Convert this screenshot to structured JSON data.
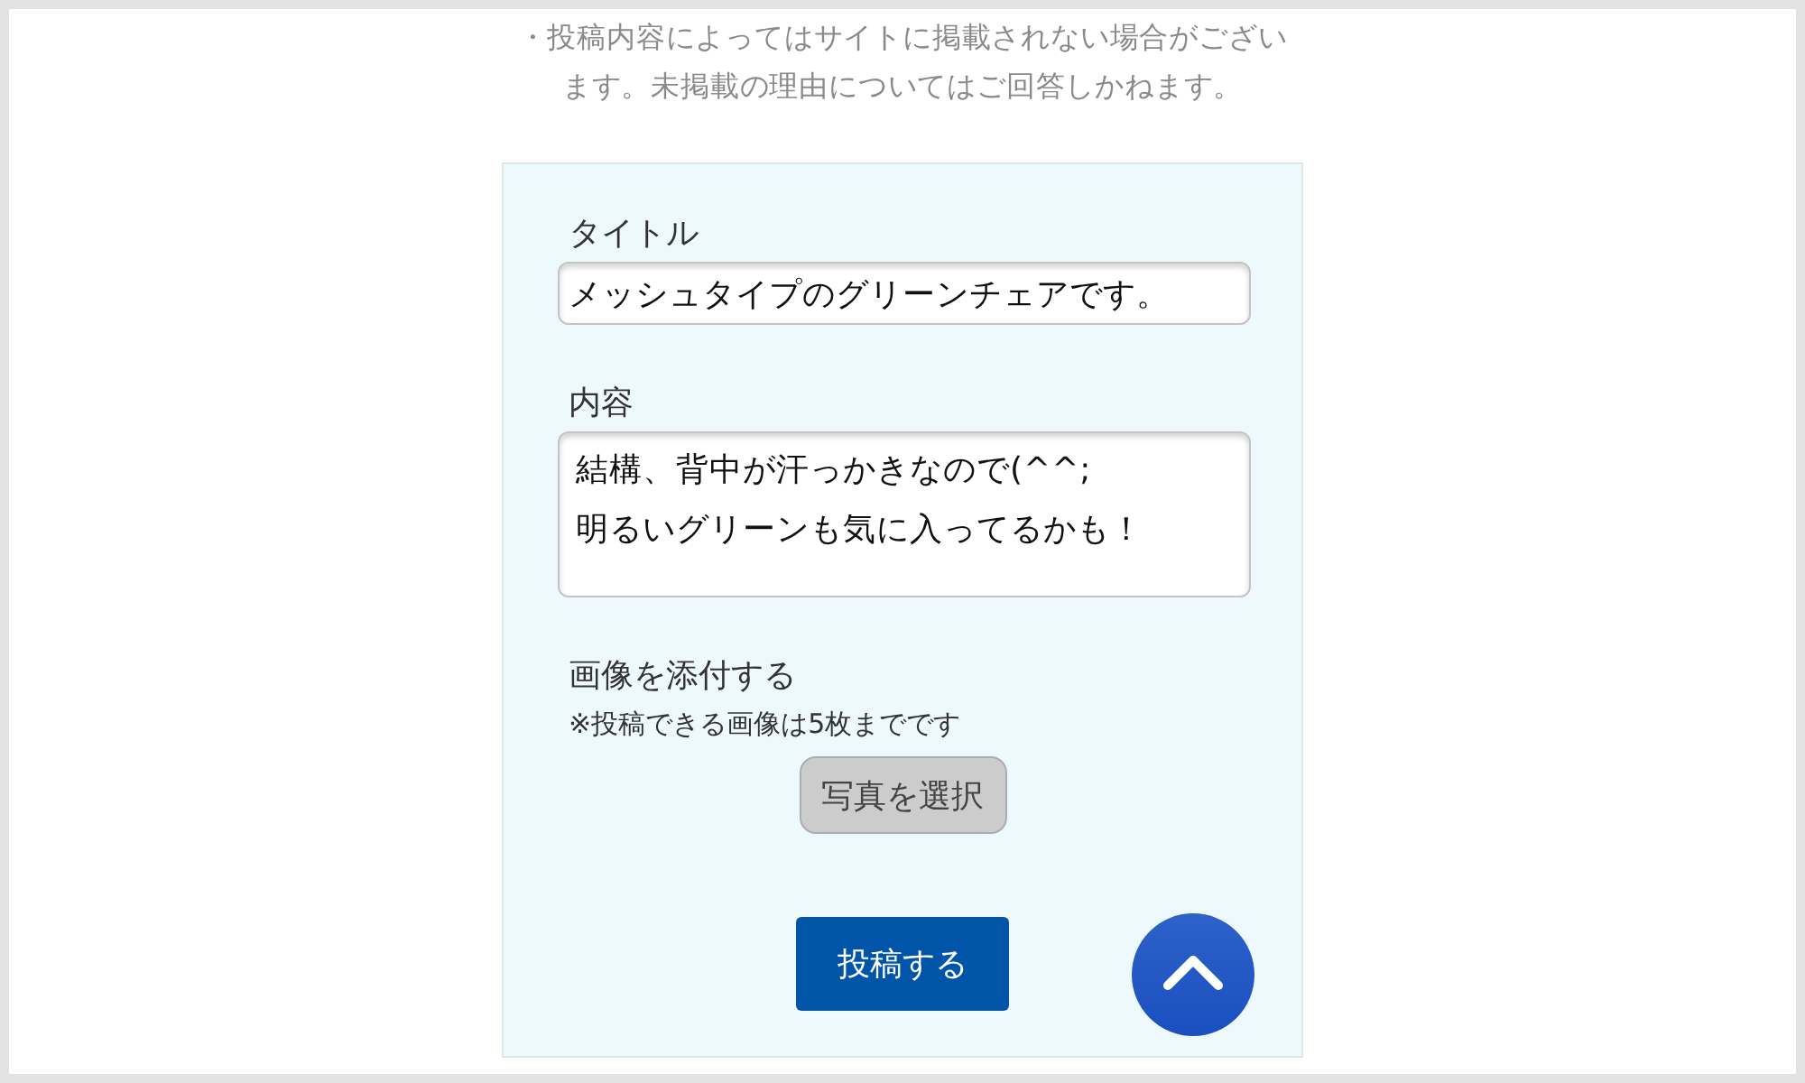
{
  "notice": "・投稿内容によってはサイトに掲載されない場合がございます。未掲載の理由についてはご回答しかねます。",
  "form": {
    "fields": [
      {
        "kind": "text",
        "label": "タイトル",
        "value": "メッシュタイプのグリーンチェアです。"
      },
      {
        "kind": "textarea",
        "label": "内容",
        "value": "結構、背中が汗っかきなので(^^;\n明るいグリーンも気に入ってるかも！"
      }
    ],
    "attachment": {
      "label": "画像を添付する",
      "note": "※投稿できる画像は5枚までです",
      "button": "写真を選択"
    },
    "submit_button": "投稿する"
  }
}
